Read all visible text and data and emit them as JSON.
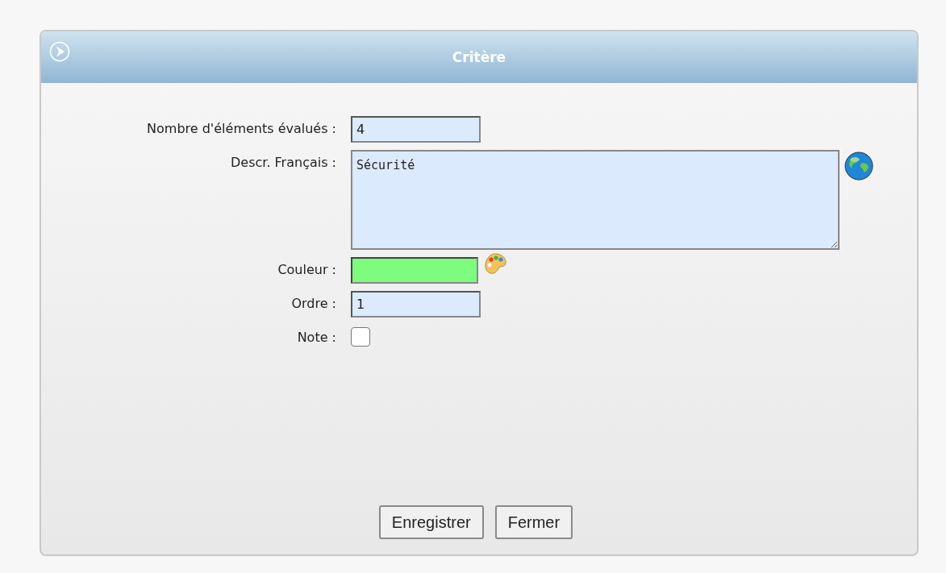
{
  "dialog": {
    "title": "Critère"
  },
  "fields": [
    {
      "kind": "text",
      "label": "Nombre d'éléments évalués :",
      "value": "4"
    },
    {
      "kind": "textarea",
      "label": "Descr. Français :",
      "value": "Sécurité"
    },
    {
      "kind": "color",
      "label": "Couleur :",
      "color": "#7dfc7d"
    },
    {
      "kind": "text",
      "label": "Ordre :",
      "value": "1"
    },
    {
      "kind": "checkbox",
      "label": "Note :",
      "checked": false
    }
  ],
  "buttons": [
    "Enregistrer",
    "Fermer"
  ]
}
